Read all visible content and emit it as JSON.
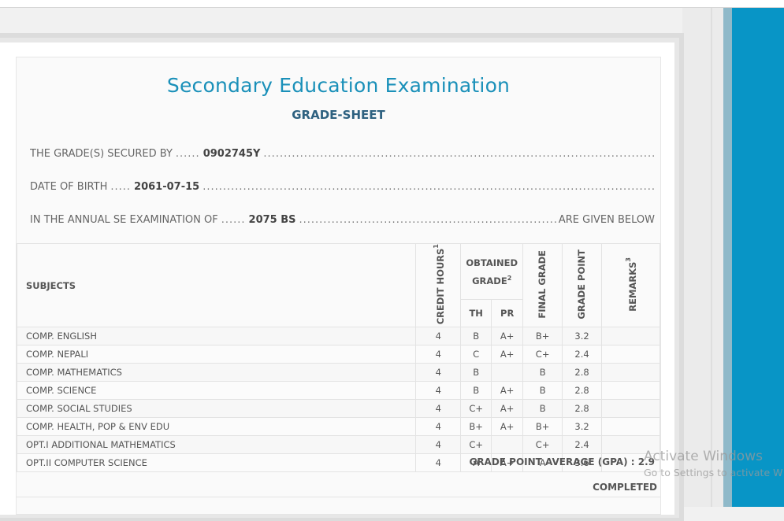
{
  "sheet": {
    "title": "Secondary Education Examination",
    "subtitle": "GRADE-SHEET"
  },
  "info": {
    "secured_by_label": "THE GRADE(S) SECURED BY",
    "secured_by_value": "0902745Y",
    "dob_label": "DATE OF BIRTH",
    "dob_value": "2061-07-15",
    "exam_label": "IN THE ANNUAL SE EXAMINATION OF",
    "exam_value": "2075 BS",
    "exam_suffix": "ARE GIVEN BELOW"
  },
  "table": {
    "headers": {
      "subjects": "SUBJECTS",
      "credit_hours": "CREDIT HOURS",
      "credit_hours_note": "1",
      "obtained_grade": "OBTAINED GRADE",
      "obtained_grade_note": "2",
      "th": "TH",
      "pr": "PR",
      "final_grade": "FINAL GRADE",
      "grade_point": "GRADE POINT",
      "remarks": "REMARKS",
      "remarks_note": "3"
    },
    "rows": [
      {
        "subject": "COMP. ENGLISH",
        "credit": "4",
        "th": "B",
        "pr": "A+",
        "final": "B+",
        "point": "3.2",
        "remarks": ""
      },
      {
        "subject": "COMP. NEPALI",
        "credit": "4",
        "th": "C",
        "pr": "A+",
        "final": "C+",
        "point": "2.4",
        "remarks": ""
      },
      {
        "subject": "COMP. MATHEMATICS",
        "credit": "4",
        "th": "B",
        "pr": "",
        "final": "B",
        "point": "2.8",
        "remarks": ""
      },
      {
        "subject": "COMP. SCIENCE",
        "credit": "4",
        "th": "B",
        "pr": "A+",
        "final": "B",
        "point": "2.8",
        "remarks": ""
      },
      {
        "subject": "COMP. SOCIAL STUDIES",
        "credit": "4",
        "th": "C+",
        "pr": "A+",
        "final": "B",
        "point": "2.8",
        "remarks": ""
      },
      {
        "subject": "COMP. HEALTH, POP & ENV EDU",
        "credit": "4",
        "th": "B+",
        "pr": "A+",
        "final": "B+",
        "point": "3.2",
        "remarks": ""
      },
      {
        "subject": "OPT.I ADDITIONAL MATHEMATICS",
        "credit": "4",
        "th": "C+",
        "pr": "",
        "final": "C+",
        "point": "2.4",
        "remarks": ""
      },
      {
        "subject": "OPT.II COMPUTER SCIENCE",
        "credit": "4",
        "th": "A",
        "pr": "A+",
        "final": "A",
        "point": "3.6",
        "remarks": ""
      }
    ]
  },
  "summary": {
    "gpa_label": "GRADE POINT AVERAGE (GPA) :",
    "gpa_value": "2.9",
    "status": "COMPLETED"
  },
  "watermark": {
    "title": "Activate Windows",
    "subtitle": "Go to Settings to activate W"
  }
}
